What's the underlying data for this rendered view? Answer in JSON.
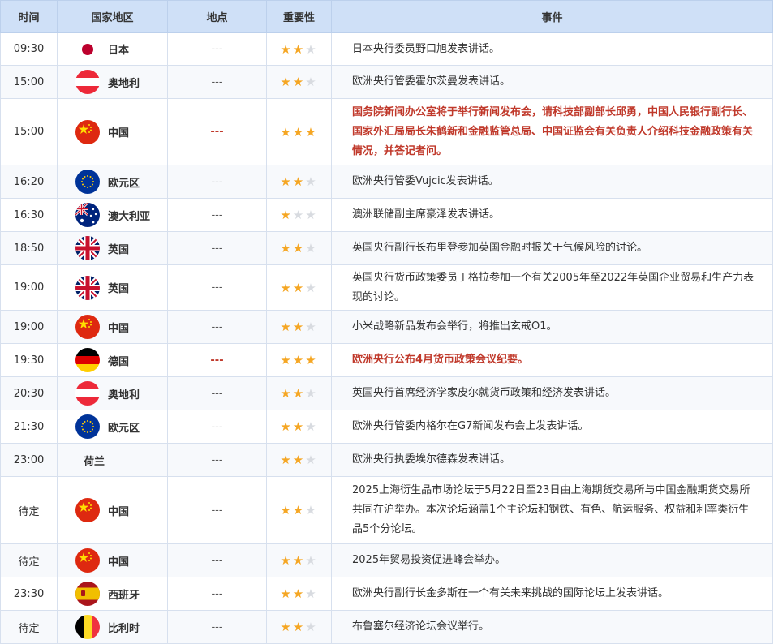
{
  "headers": {
    "time": "时间",
    "country": "国家地区",
    "location": "地点",
    "importance": "重要性",
    "event": "事件"
  },
  "star_max": 3,
  "rows": [
    {
      "time": "09:30",
      "flag": "jp-flag-icon",
      "country": "日本",
      "location": "---",
      "stars": 2,
      "highlight": false,
      "event": "日本央行委员野口旭发表讲话。"
    },
    {
      "time": "15:00",
      "flag": "at-flag-icon",
      "country": "奥地利",
      "location": "---",
      "stars": 2,
      "highlight": false,
      "event": "欧洲央行管委霍尔茨曼发表讲话。"
    },
    {
      "time": "15:00",
      "flag": "cn-flag-icon",
      "country": "中国",
      "location": "---",
      "stars": 3,
      "highlight": true,
      "event": "国务院新闻办公室将于举行新闻发布会，请科技部副部长邱勇，中国人民银行副行长、国家外汇局局长朱鹤新和金融监管总局、中国证监会有关负责人介绍科技金融政策有关情况，并答记者问。"
    },
    {
      "time": "16:20",
      "flag": "eu-flag-icon",
      "country": "欧元区",
      "location": "---",
      "stars": 2,
      "highlight": false,
      "event": "欧洲央行管委Vujcic发表讲话。"
    },
    {
      "time": "16:30",
      "flag": "au-flag-icon",
      "country": "澳大利亚",
      "location": "---",
      "stars": 1,
      "highlight": false,
      "event": "澳洲联储副主席豪泽发表讲话。"
    },
    {
      "time": "18:50",
      "flag": "gb-flag-icon",
      "country": "英国",
      "location": "---",
      "stars": 2,
      "highlight": false,
      "event": "英国央行副行长布里登参加英国金融时报关于气候风险的讨论。"
    },
    {
      "time": "19:00",
      "flag": "gb-flag-icon",
      "country": "英国",
      "location": "---",
      "stars": 2,
      "highlight": false,
      "event": "英国央行货币政策委员丁格拉参加一个有关2005年至2022年英国企业贸易和生产力表现的讨论。"
    },
    {
      "time": "19:00",
      "flag": "cn-flag-icon",
      "country": "中国",
      "location": "---",
      "stars": 2,
      "highlight": false,
      "event": "小米战略新品发布会举行，将推出玄戒O1。"
    },
    {
      "time": "19:30",
      "flag": "de-flag-icon",
      "country": "德国",
      "location": "---",
      "stars": 3,
      "highlight": true,
      "event": "欧洲央行公布4月货币政策会议纪要。"
    },
    {
      "time": "20:30",
      "flag": "at-flag-icon",
      "country": "奥地利",
      "location": "---",
      "stars": 2,
      "highlight": false,
      "event": "英国央行首席经济学家皮尔就货币政策和经济发表讲话。"
    },
    {
      "time": "21:30",
      "flag": "eu-flag-icon",
      "country": "欧元区",
      "location": "---",
      "stars": 2,
      "highlight": false,
      "event": "欧洲央行管委内格尔在G7新闻发布会上发表讲话。"
    },
    {
      "time": "23:00",
      "flag": "",
      "country": "荷兰",
      "location": "---",
      "stars": 2,
      "highlight": false,
      "event": "欧洲央行执委埃尔德森发表讲话。"
    },
    {
      "time": "待定",
      "flag": "cn-flag-icon",
      "country": "中国",
      "location": "---",
      "stars": 2,
      "highlight": false,
      "event": "2025上海衍生品市场论坛于5月22日至23日由上海期货交易所与中国金融期货交易所共同在沪举办。本次论坛涵盖1个主论坛和钢铁、有色、航运服务、权益和利率类衍生品5个分论坛。"
    },
    {
      "time": "待定",
      "flag": "cn-flag-icon",
      "country": "中国",
      "location": "---",
      "stars": 2,
      "highlight": false,
      "event": "2025年贸易投资促进峰会举办。"
    },
    {
      "time": "23:30",
      "flag": "es-flag-icon",
      "country": "西班牙",
      "location": "---",
      "stars": 2,
      "highlight": false,
      "event": "欧洲央行副行长金多斯在一个有关未来挑战的国际论坛上发表讲话。"
    },
    {
      "time": "待定",
      "flag": "be-flag-icon",
      "country": "比利时",
      "location": "---",
      "stars": 2,
      "highlight": false,
      "event": "布鲁塞尔经济论坛会议举行。"
    }
  ]
}
